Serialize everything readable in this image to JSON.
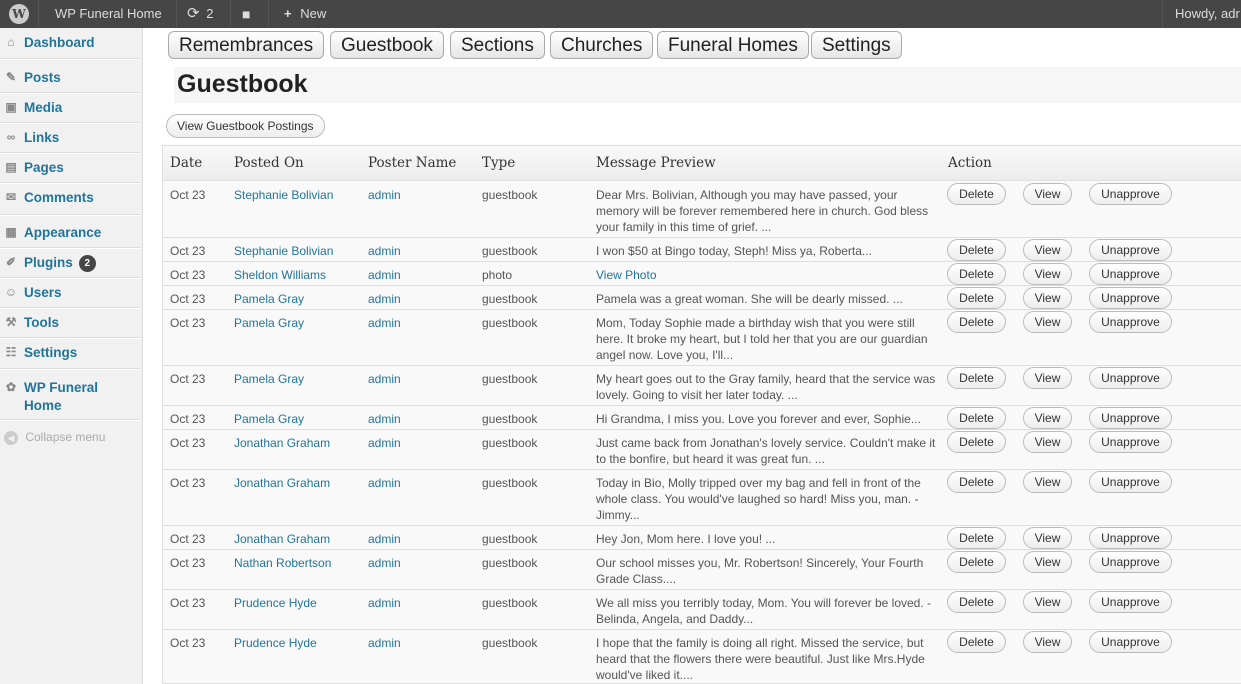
{
  "adminbar": {
    "logo": "W",
    "site_name": "WP Funeral Home",
    "updates_count": "2",
    "new_label": "New",
    "howdy": "Howdy, adr"
  },
  "sidebar": {
    "items": [
      {
        "icon": "dashboard-icon",
        "glyph": "⌂",
        "label": "Dashboard"
      },
      {
        "icon": "posts-icon",
        "glyph": "✎",
        "label": "Posts"
      },
      {
        "icon": "media-icon",
        "glyph": "▣",
        "label": "Media"
      },
      {
        "icon": "links-icon",
        "glyph": "∞",
        "label": "Links"
      },
      {
        "icon": "pages-icon",
        "glyph": "▤",
        "label": "Pages"
      },
      {
        "icon": "comments-icon",
        "glyph": "✉",
        "label": "Comments"
      },
      {
        "icon": "appearance-icon",
        "glyph": "▦",
        "label": "Appearance"
      },
      {
        "icon": "plugins-icon",
        "glyph": "✐",
        "label": "Plugins",
        "badge": "2"
      },
      {
        "icon": "users-icon",
        "glyph": "☺",
        "label": "Users"
      },
      {
        "icon": "tools-icon",
        "glyph": "⚒",
        "label": "Tools"
      },
      {
        "icon": "settings-icon",
        "glyph": "☷",
        "label": "Settings"
      },
      {
        "icon": "funeral-home-icon",
        "glyph": "✿",
        "label": "WP Funeral Home"
      }
    ],
    "collapse_label": "Collapse menu"
  },
  "tabs": [
    "Remembrances",
    "Guestbook",
    "Sections",
    "Churches",
    "Funeral Homes",
    "Settings"
  ],
  "page_title": "Guestbook",
  "view_postings_label": "View Guestbook Postings",
  "table": {
    "headers": [
      "Date",
      "Posted On",
      "Poster Name",
      "Type",
      "Message Preview",
      "Action"
    ],
    "actions": {
      "delete": "Delete",
      "view": "View",
      "unapprove": "Unapprove"
    },
    "rows": [
      {
        "date": "Oct 23",
        "posted_on": "Stephanie Bolivian",
        "poster": "admin",
        "type": "guestbook",
        "message": "Dear Mrs. Bolivian, Although you may have passed, your memory will be forever remembered here in church. God bless your family in this time of grief. ..."
      },
      {
        "date": "Oct 23",
        "posted_on": "Stephanie Bolivian",
        "poster": "admin",
        "type": "guestbook",
        "message": "I won $50 at Bingo today, Steph! Miss ya, Roberta..."
      },
      {
        "date": "Oct 23",
        "posted_on": "Sheldon Williams",
        "poster": "admin",
        "type": "photo",
        "message": "View Photo",
        "message_link": true
      },
      {
        "date": "Oct 23",
        "posted_on": "Pamela Gray",
        "poster": "admin",
        "type": "guestbook",
        "message": "Pamela was a great woman. She will be dearly missed. ..."
      },
      {
        "date": "Oct 23",
        "posted_on": "Pamela Gray",
        "poster": "admin",
        "type": "guestbook",
        "message": "Mom, Today Sophie made a birthday wish that you were still here. It broke my heart, but I told her that you are our guardian angel now. Love you, I'll..."
      },
      {
        "date": "Oct 23",
        "posted_on": "Pamela Gray",
        "poster": "admin",
        "type": "guestbook",
        "message": "My heart goes out to the Gray family, heard that the service was lovely. Going to visit her later today. ..."
      },
      {
        "date": "Oct 23",
        "posted_on": "Pamela Gray",
        "poster": "admin",
        "type": "guestbook",
        "message": "Hi Grandma, I miss you. Love you forever and ever, Sophie..."
      },
      {
        "date": "Oct 23",
        "posted_on": "Jonathan Graham",
        "poster": "admin",
        "type": "guestbook",
        "message": "Just came back from Jonathan's lovely service. Couldn't make it to the bonfire, but heard it was great fun. ..."
      },
      {
        "date": "Oct 23",
        "posted_on": "Jonathan Graham",
        "poster": "admin",
        "type": "guestbook",
        "message": "Today in Bio, Molly tripped over my bag and fell in front of the whole class. You would've laughed so hard! Miss you, man. -Jimmy..."
      },
      {
        "date": "Oct 23",
        "posted_on": "Jonathan Graham",
        "poster": "admin",
        "type": "guestbook",
        "message": "Hey Jon, Mom here. I love you! ..."
      },
      {
        "date": "Oct 23",
        "posted_on": "Nathan Robertson",
        "poster": "admin",
        "type": "guestbook",
        "message": "Our school misses you, Mr. Robertson! Sincerely, Your Fourth Grade Class...."
      },
      {
        "date": "Oct 23",
        "posted_on": "Prudence Hyde",
        "poster": "admin",
        "type": "guestbook",
        "message": "We all miss you terribly today, Mom. You will forever be loved. -Belinda, Angela, and Daddy..."
      },
      {
        "date": "Oct 23",
        "posted_on": "Prudence Hyde",
        "poster": "admin",
        "type": "guestbook",
        "message": "I hope that the family is doing all right. Missed the service, but heard that the flowers there were beautiful. Just like Mrs.Hyde would've liked it...."
      }
    ]
  }
}
